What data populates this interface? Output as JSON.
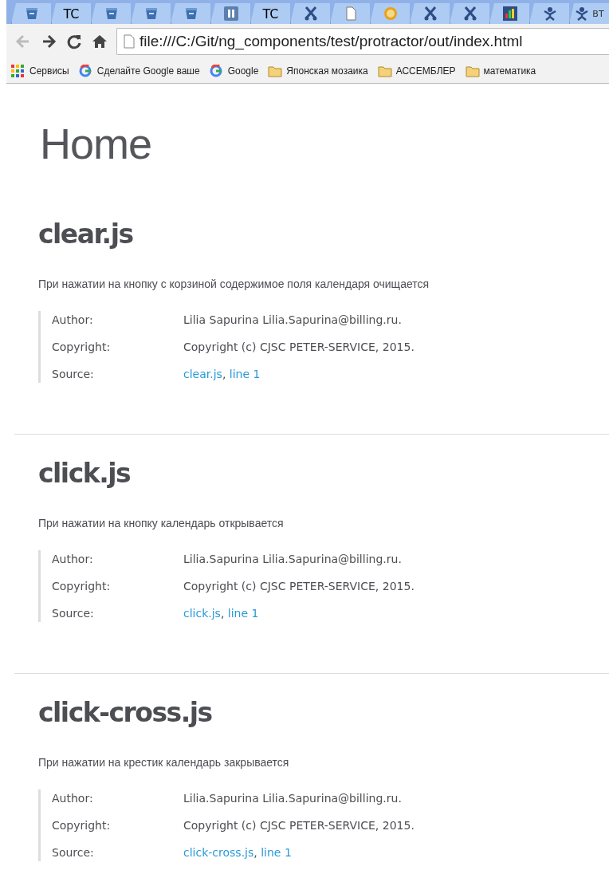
{
  "browser": {
    "tabs": [
      {
        "kind": "bucket"
      },
      {
        "kind": "tc",
        "badge": "TC"
      },
      {
        "kind": "bucket"
      },
      {
        "kind": "bucket"
      },
      {
        "kind": "bucket"
      },
      {
        "kind": "pause"
      },
      {
        "kind": "tc",
        "badge": "TC"
      },
      {
        "kind": "scissors"
      },
      {
        "kind": "page"
      },
      {
        "kind": "coin"
      },
      {
        "kind": "scissors"
      },
      {
        "kind": "scissors"
      },
      {
        "kind": "grid"
      },
      {
        "kind": "figure"
      },
      {
        "kind": "figure",
        "title": "ВТ"
      }
    ],
    "address": "file:///C:/Git/ng_components/test/protractor/out/index.html",
    "bookmarks": [
      {
        "kind": "apps",
        "label": "Сервисы"
      },
      {
        "kind": "google",
        "label": "Сделайте Google ваше"
      },
      {
        "kind": "google",
        "label": "Google"
      },
      {
        "kind": "folder",
        "label": "Японская мозаика"
      },
      {
        "kind": "folder",
        "label": "АССЕМБЛЕР"
      },
      {
        "kind": "folder",
        "label": "математика"
      }
    ]
  },
  "page": {
    "title": "Home",
    "sections": [
      {
        "name": "clear.js",
        "description": "При нажатии на кнопку с корзиной содержимое поля календаря очищается",
        "author_label": "Author:",
        "author": "Lilia Sapurina Lilia.Sapurina@billing.ru.",
        "copyright_label": "Copyright:",
        "copyright": "Copyright (c) CJSC PETER-SERVICE, 2015.",
        "source_label": "Source:",
        "source_file": "clear.js",
        "source_separator": ",",
        "source_line": "line 1"
      },
      {
        "name": "click.js",
        "description": "При нажатии на кнопку календарь открывается",
        "author_label": "Author:",
        "author": "Lilia.Sapurina Lilia.Sapurina@billing.ru.",
        "copyright_label": "Copyright:",
        "copyright": "Copyright (c) CJSC PETER-SERVICE, 2015.",
        "source_label": "Source:",
        "source_file": "click.js",
        "source_separator": ",",
        "source_line": "line 1"
      },
      {
        "name": "click-cross.js",
        "description": "При нажатии на крестик календарь закрывается",
        "author_label": "Author:",
        "author": "Lilia.Sapurina Lilia.Sapurina@billing.ru.",
        "copyright_label": "Copyright:",
        "copyright": "Copyright (c) CJSC PETER-SERVICE, 2015.",
        "source_label": "Source:",
        "source_file": "click-cross.js",
        "source_separator": ",",
        "source_line": "line 1"
      }
    ]
  }
}
